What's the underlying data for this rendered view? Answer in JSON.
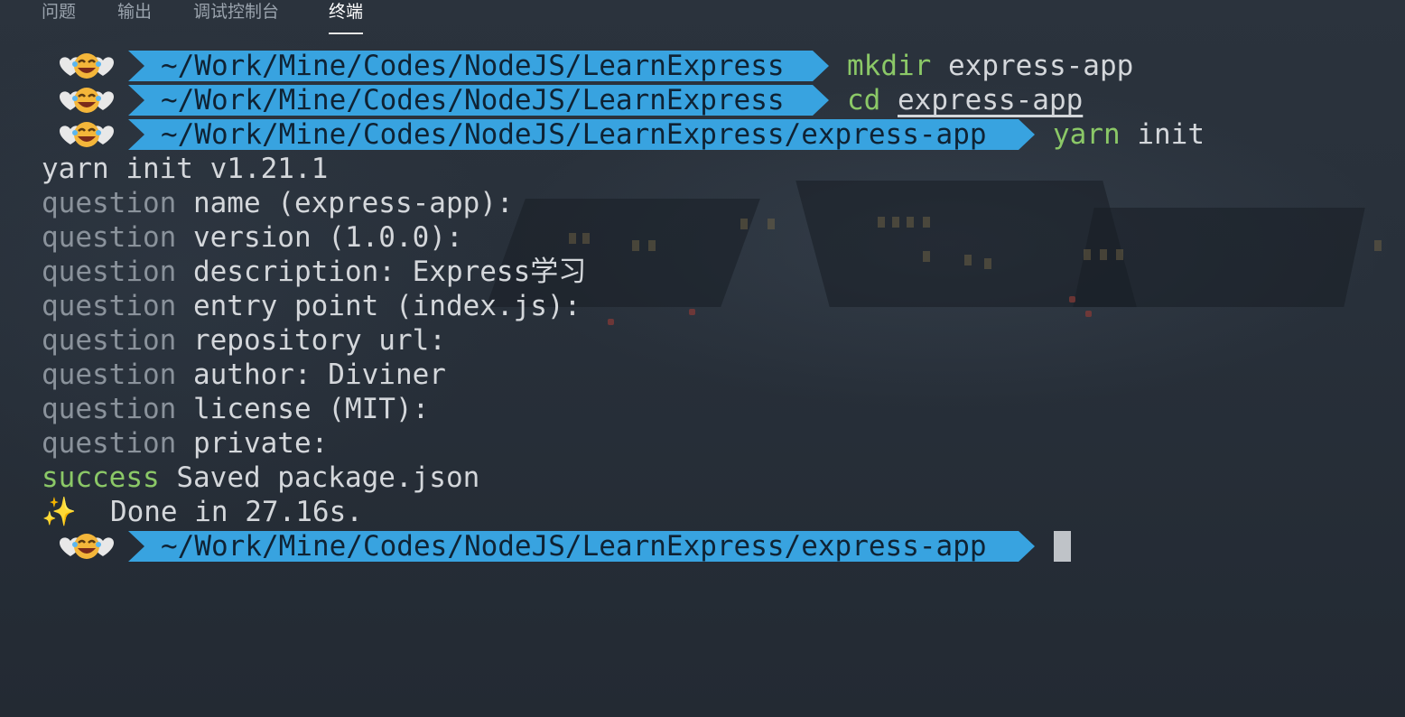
{
  "tabs": [
    {
      "label": "问题",
      "active": false
    },
    {
      "label": "输出",
      "active": false
    },
    {
      "label": "调试控制台",
      "active": false
    },
    {
      "label": "终端",
      "active": true
    }
  ],
  "colors": {
    "prompt_segment": "#38a3e0",
    "command_green": "#8bc867",
    "dim_text": "#8a929b",
    "text": "#d4d7db"
  },
  "prompt_icon": "hearts-laughing-face-emoji",
  "terminal": {
    "prompt1": {
      "path": "~/Work/Mine/Codes/NodeJS/LearnExpress",
      "cmd": "mkdir",
      "arg": "express-app"
    },
    "prompt2": {
      "path": "~/Work/Mine/Codes/NodeJS/LearnExpress",
      "cmd": "cd",
      "arg": "express-app"
    },
    "prompt3": {
      "path": "~/Work/Mine/Codes/NodeJS/LearnExpress/express-app",
      "cmd": "yarn",
      "arg": "init"
    },
    "header": "yarn init v1.21.1",
    "question_word": "question",
    "questions": [
      "name (express-app):",
      "version (1.0.0):",
      "description: Express学习",
      "entry point (index.js):",
      "repository url:",
      "author: Diviner",
      "license (MIT):",
      "private:"
    ],
    "success_word": "success",
    "success_msg": "Saved package.json",
    "done_icon": "✨",
    "done_msg": "Done in 27.16s.",
    "prompt4": {
      "path": "~/Work/Mine/Codes/NodeJS/LearnExpress/express-app"
    }
  }
}
